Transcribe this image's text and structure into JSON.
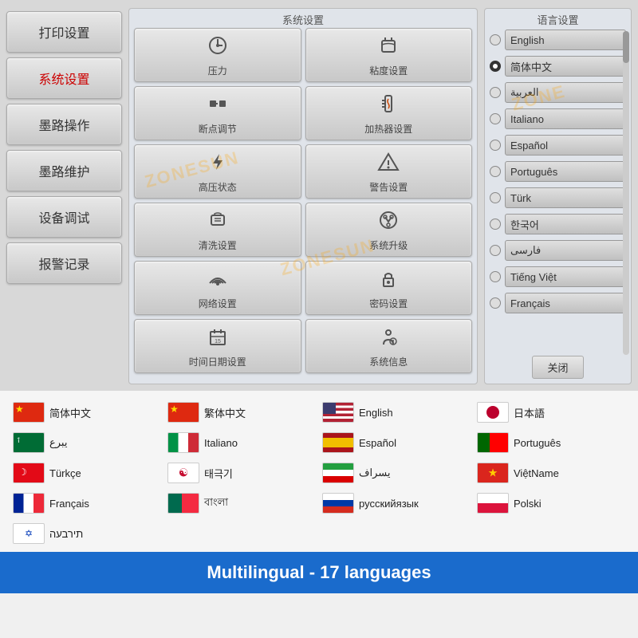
{
  "topPanel": {
    "title": "系统设置",
    "watermarks": [
      "ZONESUN",
      "ZONESUN",
      "ZONE"
    ],
    "sidebar": {
      "buttons": [
        {
          "id": "print-settings",
          "label": "打印设置",
          "active": false
        },
        {
          "id": "system-settings",
          "label": "系统设置",
          "active": true
        },
        {
          "id": "ink-operation",
          "label": "墨路操作",
          "active": false
        },
        {
          "id": "ink-maintenance",
          "label": "墨路维护",
          "active": false
        },
        {
          "id": "device-debug",
          "label": "设备调试",
          "active": false
        },
        {
          "id": "alarm-log",
          "label": "报警记录",
          "active": false
        }
      ]
    },
    "centerMenu": {
      "title": "系统设置",
      "items": [
        {
          "id": "pressure",
          "icon": "⏱",
          "label": "压力"
        },
        {
          "id": "viscosity",
          "icon": "🏺",
          "label": "粘度设置"
        },
        {
          "id": "breakpoint",
          "icon": "▬▬",
          "label": "断点调节"
        },
        {
          "id": "heater",
          "icon": "🌡",
          "label": "加热器设置"
        },
        {
          "id": "high-voltage",
          "icon": "⚡",
          "label": "高压状态"
        },
        {
          "id": "alarm",
          "icon": "⚠",
          "label": "警告设置"
        },
        {
          "id": "purge",
          "icon": "💠",
          "label": "清洗设置"
        },
        {
          "id": "system-upgrade",
          "icon": "⚙",
          "label": "系统升级"
        },
        {
          "id": "network",
          "icon": "📶",
          "label": "网络设置"
        },
        {
          "id": "password",
          "icon": "🔒",
          "label": "密码设置"
        },
        {
          "id": "datetime",
          "icon": "📅",
          "label": "时间日期设置"
        },
        {
          "id": "sysinfo",
          "icon": "👤",
          "label": "系统信息"
        }
      ]
    },
    "languagePanel": {
      "title": "语言设置",
      "languages": [
        {
          "id": "english",
          "label": "English",
          "selected": false
        },
        {
          "id": "simplified-chinese",
          "label": "简体中文",
          "selected": true
        },
        {
          "id": "arabic",
          "label": "العربية",
          "selected": false
        },
        {
          "id": "italian",
          "label": "Italiano",
          "selected": false
        },
        {
          "id": "spanish",
          "label": "Español",
          "selected": false
        },
        {
          "id": "portuguese",
          "label": "Português",
          "selected": false
        },
        {
          "id": "turkish",
          "label": "Türk",
          "selected": false
        },
        {
          "id": "korean",
          "label": "한국어",
          "selected": false
        },
        {
          "id": "persian",
          "label": "فارسی",
          "selected": false
        },
        {
          "id": "vietnamese",
          "label": "Tiếng Việt",
          "selected": false
        },
        {
          "id": "french",
          "label": "Français",
          "selected": false
        }
      ],
      "closeBtn": "关闭"
    }
  },
  "langGrid": {
    "items": [
      {
        "id": "simplified-chinese",
        "flag": "china",
        "name": "简体中文"
      },
      {
        "id": "traditional-chinese",
        "flag": "china",
        "name": "繁体中文"
      },
      {
        "id": "english",
        "flag": "usa",
        "name": "English"
      },
      {
        "id": "japanese",
        "flag": "japan",
        "name": "日本語"
      },
      {
        "id": "arabic",
        "flag": "saudi",
        "name": "يبرع"
      },
      {
        "id": "italian",
        "flag": "italy",
        "name": "Italiano"
      },
      {
        "id": "spanish",
        "flag": "spain",
        "name": "Español"
      },
      {
        "id": "portuguese",
        "flag": "portugal",
        "name": "Português"
      },
      {
        "id": "turkish",
        "flag": "turkey",
        "name": "Türkçe"
      },
      {
        "id": "korean",
        "flag": "korea",
        "name": "태극기"
      },
      {
        "id": "persian",
        "flag": "iran",
        "name": "یسراف"
      },
      {
        "id": "vietnamese",
        "flag": "vietnam",
        "name": "ViệtName"
      },
      {
        "id": "french",
        "flag": "france",
        "name": "Français"
      },
      {
        "id": "bengali",
        "flag": "bangladesh",
        "name": "বাংলা"
      },
      {
        "id": "russian",
        "flag": "russia",
        "name": "русскийязык"
      },
      {
        "id": "polish",
        "flag": "poland",
        "name": "Polski"
      },
      {
        "id": "hebrew",
        "flag": "israel",
        "name": "תירבעה"
      }
    ]
  },
  "bottomBanner": {
    "text": "Multilingual - 17 languages"
  }
}
